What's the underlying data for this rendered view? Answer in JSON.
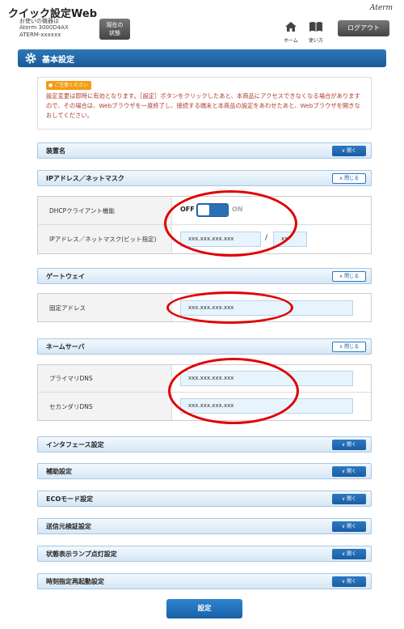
{
  "header": {
    "app_title": "クイック設定Web",
    "device_lines": [
      "お使いの機器は",
      "Aterm 3000D4AX",
      "ATERM-xxxxxx"
    ],
    "status_button_lines": [
      "現在の",
      "状態"
    ],
    "brand": "Aterm",
    "home_label": "ホーム",
    "help_label": "使い方",
    "logout_label": "ログアウト"
  },
  "page": {
    "title": "基本設定"
  },
  "notice": {
    "badge": "ご注意ください",
    "text": "設定変更は即時に有効となります。［設定］ボタンをクリックしたあと、本商品にアクセスできなくなる場合がありますので、その場合は、Webブラウザを一度終了し、接続する端末と本商品の設定をあわせたあと、Webブラウザを開きなおしてください。"
  },
  "labels": {
    "open": "開く",
    "close": "閉じる"
  },
  "sections": {
    "device_name": "装置名",
    "ip": "IPアドレス／ネットマスク",
    "gateway": "ゲートウェイ",
    "nameserver": "ネームサーバ",
    "interface": "インタフェース設定",
    "aux": "補助設定",
    "eco": "ECOモード設定",
    "src_verify": "送信元検証設定",
    "lamp": "状態表示ランプ点灯設定",
    "reboot": "時刻指定再起動設定"
  },
  "ip_panel": {
    "dhcp_label": "DHCPクライアント機能",
    "switch_off": "OFF",
    "switch_on": "ON",
    "switch_state": "OFF",
    "ip_label": "IPアドレス／ネットマスク(ビット指定)",
    "ip_value": "xxx.xxx.xxx.xxx",
    "slash": "/",
    "mask_value": "xx"
  },
  "gateway_panel": {
    "fixed_label": "固定アドレス",
    "fixed_value": "xxx.xxx.xxx.xxx"
  },
  "dns_panel": {
    "primary_label": "プライマリDNS",
    "primary_value": "xxx.xxx.xxx.xxx",
    "secondary_label": "セカンダリDNS",
    "secondary_value": "xxx.xxx.xxx.xxx"
  },
  "submit_label": "設定",
  "colors": {
    "accent_blue": "#1a5ea4",
    "section_bg": "#d6e7f5",
    "field_bg": "#e8f4fd",
    "notice_text": "#b03a2e",
    "notice_badge": "#f39c12",
    "annotation_red": "#e00000"
  },
  "icons": {
    "settings": "gear-icon",
    "home": "home-icon",
    "help": "book-icon",
    "open": "chevron-down-icon",
    "close": "chevron-up-icon",
    "notice": "exclamation-icon"
  }
}
